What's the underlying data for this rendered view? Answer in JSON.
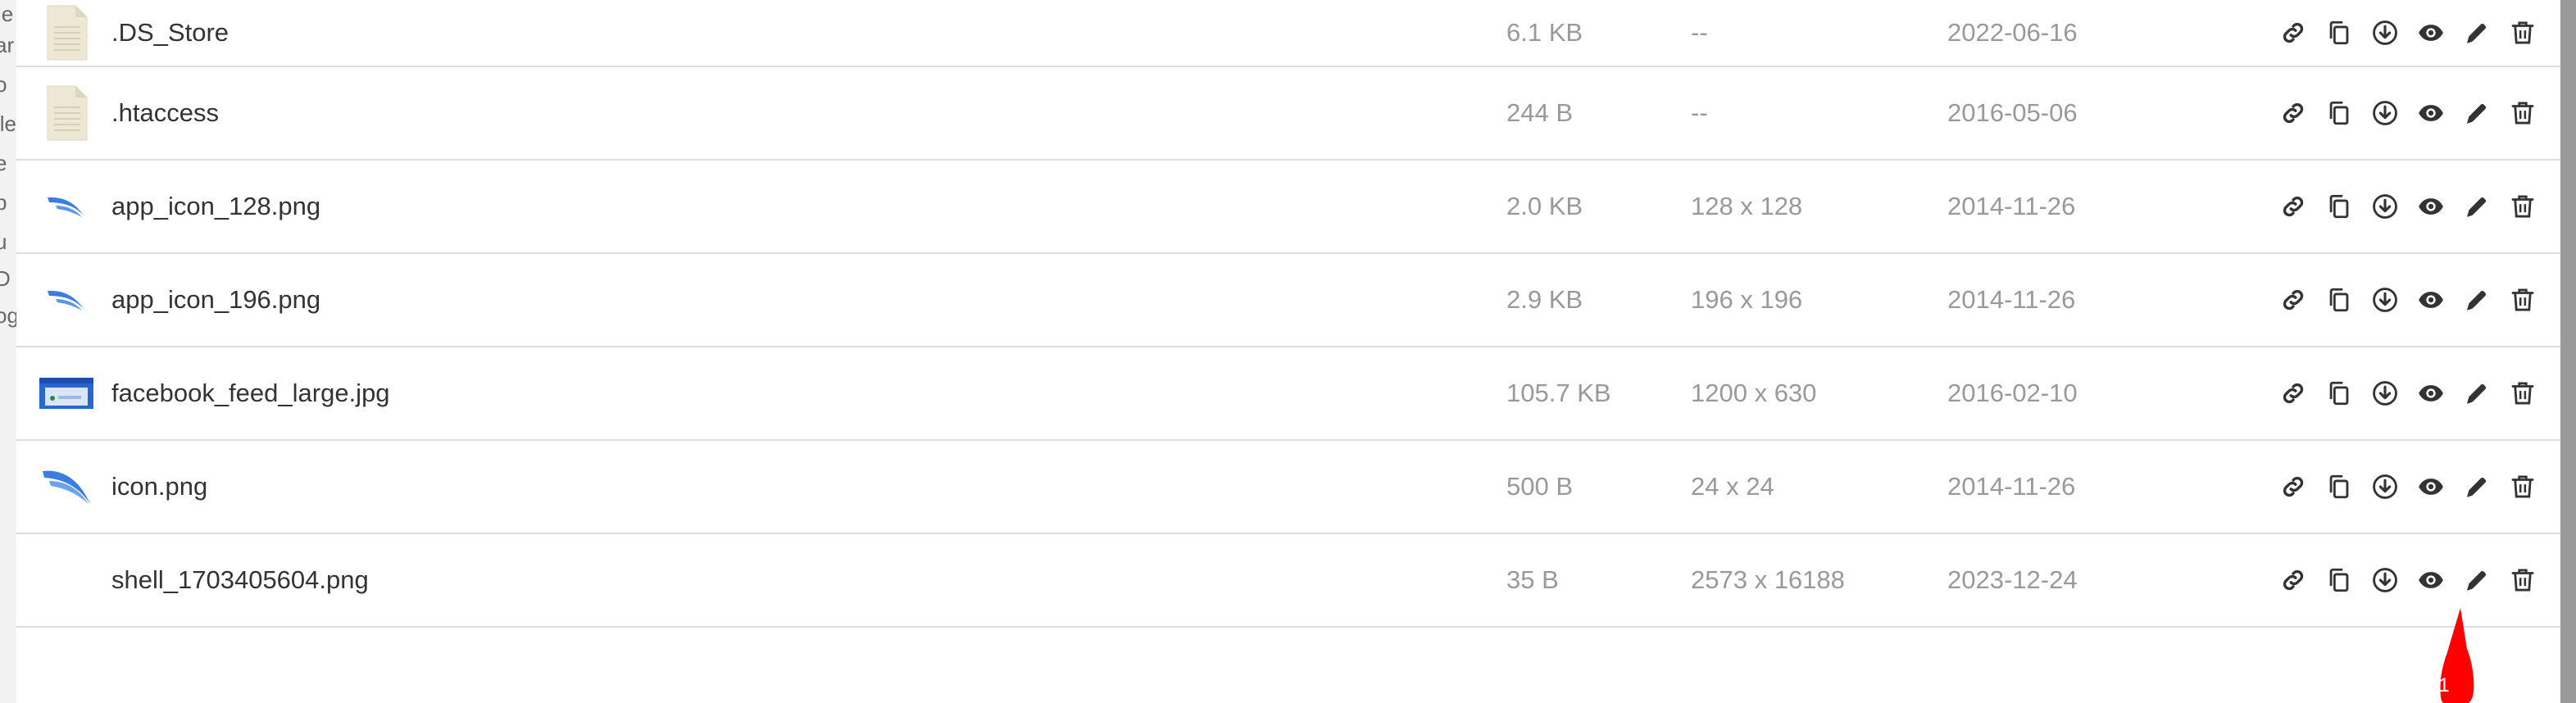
{
  "underlay": {
    "fragments": [
      "le",
      "ar",
      "o",
      "ile",
      "e",
      "p",
      "u",
      "D",
      "og"
    ]
  },
  "files": [
    {
      "name": ".DS_Store",
      "size": "6.1 KB",
      "dims": "--",
      "date": "2022-06-16",
      "thumb": "doc"
    },
    {
      "name": ".htaccess",
      "size": "244 B",
      "dims": "--",
      "date": "2016-05-06",
      "thumb": "doc"
    },
    {
      "name": "app_icon_128.png",
      "size": "2.0 KB",
      "dims": "128 x 128",
      "date": "2014-11-26",
      "thumb": "swoosh-small"
    },
    {
      "name": "app_icon_196.png",
      "size": "2.9 KB",
      "dims": "196 x 196",
      "date": "2014-11-26",
      "thumb": "swoosh-small"
    },
    {
      "name": "facebook_feed_large.jpg",
      "size": "105.7 KB",
      "dims": "1200 x 630",
      "date": "2016-02-10",
      "thumb": "feed-image"
    },
    {
      "name": "icon.png",
      "size": "500 B",
      "dims": "24 x 24",
      "date": "2014-11-26",
      "thumb": "swoosh-large"
    },
    {
      "name": "shell_1703405604.png",
      "size": "35 B",
      "dims": "2573 x 16188",
      "date": "2023-12-24",
      "thumb": "none"
    }
  ],
  "actions": [
    "link",
    "copy",
    "download",
    "view",
    "edit",
    "delete"
  ],
  "annotation": {
    "label": "1",
    "color": "#ff0000"
  },
  "colors": {
    "text": "#333333",
    "muted": "#999999",
    "icon": "#333333",
    "divider": "#dedede",
    "accent_blue": "#3b7de0"
  }
}
